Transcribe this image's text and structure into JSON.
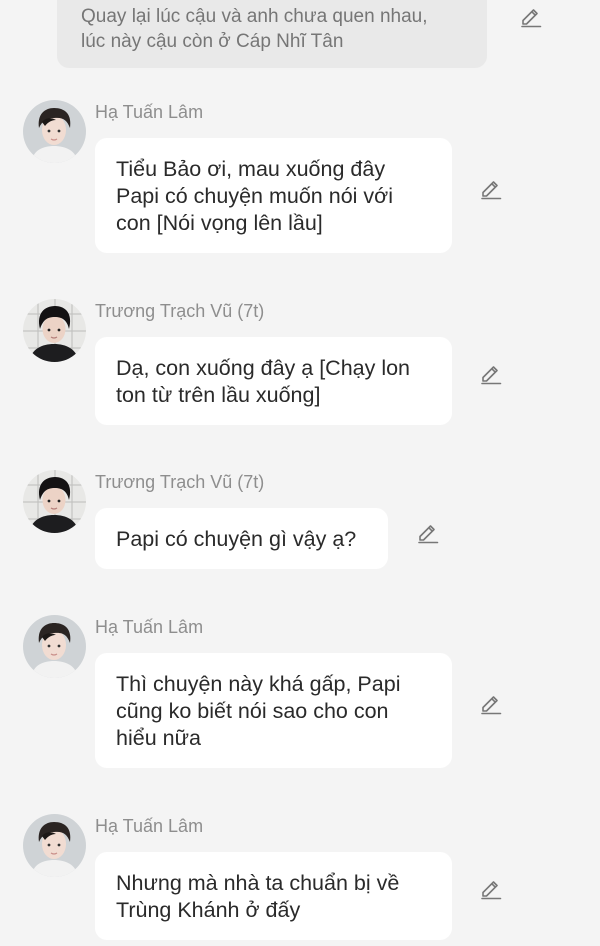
{
  "narration": {
    "line1": "Quay lại lúc cậu và anh chưa quen nhau,",
    "line2": "lúc này cậu còn ở Cáp Nhĩ Tân"
  },
  "icons": {
    "edit": "pencil-edit-icon",
    "avatar": "avatar-photo"
  },
  "colors": {
    "background": "#f4f4f4",
    "bubble": "#ffffff",
    "narration_bubble": "#e9e9e9",
    "sender_text": "#8e8e8e"
  },
  "messages": [
    {
      "sender": "Hạ Tuấn Lâm",
      "lines": [
        "Tiểu Bảo ơi, mau xuống đây",
        "Papi có chuyện muốn nói với",
        "con [Nói vọng lên lầu]"
      ]
    },
    {
      "sender": "Trương Trạch Vũ (7t)",
      "lines": [
        "Dạ, con xuống đây ạ [Chạy lon",
        "ton từ trên lầu xuống]"
      ]
    },
    {
      "sender": "Trương Trạch Vũ (7t)",
      "lines": [
        "Papi có chuyện gì vậy ạ?"
      ]
    },
    {
      "sender": "Hạ Tuấn Lâm",
      "lines": [
        "Thì chuyện này khá gấp, Papi",
        "cũng ko biết nói sao cho con",
        "hiểu nữa"
      ]
    },
    {
      "sender": "Hạ Tuấn Lâm",
      "lines": [
        "Nhưng mà nhà ta chuẩn bị về",
        "Trùng Khánh ở đấy"
      ]
    }
  ]
}
